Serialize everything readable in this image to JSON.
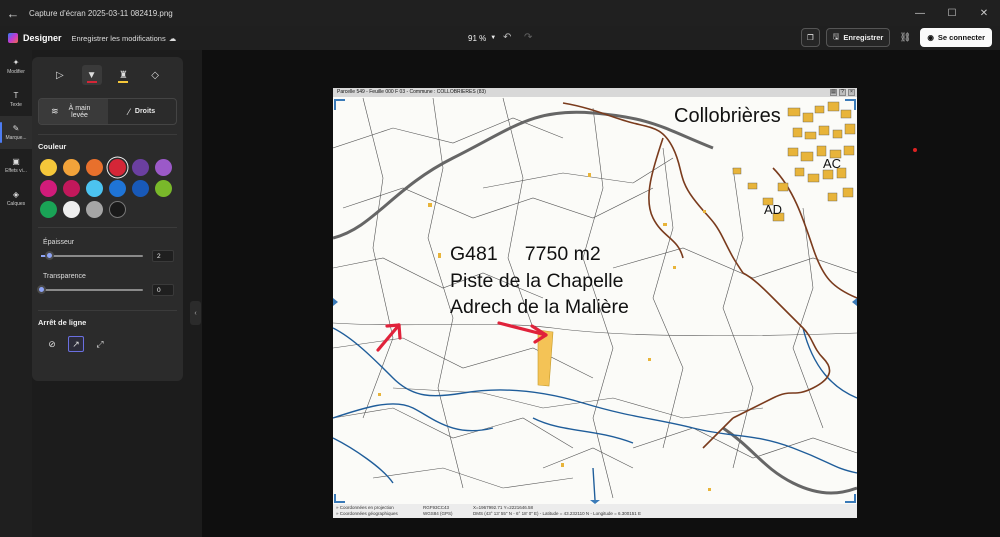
{
  "window": {
    "title": "Capture d'écran 2025-03-11 082419.png",
    "controls": [
      "—",
      "☐",
      "✕"
    ]
  },
  "appbar": {
    "app_name": "Designer",
    "save_changes": "Enregistrer les modifications",
    "zoom": "91 %",
    "save_button": "Enregistrer",
    "signin_button": "Se connecter"
  },
  "nav": [
    {
      "label": "Modifier",
      "icon": "magic-wand-icon",
      "active": false
    },
    {
      "label": "Texte",
      "icon": "text-icon",
      "active": false
    },
    {
      "label": "Marque...",
      "icon": "marker-icon",
      "active": true
    },
    {
      "label": "Effets vi...",
      "icon": "effects-icon",
      "active": false
    },
    {
      "label": "Calques",
      "icon": "layers-icon",
      "active": false
    }
  ],
  "panel": {
    "mode_freehand": "À main levée",
    "mode_straight": "Droits",
    "color_label": "Couleur",
    "colors": [
      "#f5c73a",
      "#f2a33a",
      "#e8702c",
      "#d42637",
      "#6b3fa0",
      "#9b59c8",
      "#d11b7a",
      "#c2185b",
      "#4cc3f0",
      "#1f74d6",
      "#1859b8",
      "#79b82a",
      "#1aa356",
      "#eeeeee",
      "#a6a6a6",
      "#1a1a1a"
    ],
    "selected_color": "#d42637",
    "thickness_label": "Épaisseur",
    "thickness_value": "2",
    "thickness_level": 0.08,
    "transparency_label": "Transparence",
    "transparency_value": "0",
    "transparency_level": 0,
    "line_end_label": "Arrêt de ligne"
  },
  "document": {
    "header": "Parcelle 549 - Feuille 000 F 03 - Commune : COLLOBRIERES (83)",
    "town_label": "Collobrières",
    "section_ac": "AC",
    "section_ad": "AD",
    "annotation_line1": "G481     7750 m2",
    "annotation_line2": "Piste de la Chapelle",
    "annotation_line3": "Adrech de la Malière",
    "footer": {
      "c1": "» Coordonnées en projection",
      "c2": "» Coordonnées géographiques",
      "c3": "RGF93CC43",
      "c4": "WGS84 (GPS)",
      "c5": "X=1967992.71   Y=2221646.58",
      "c6": "DMS (43° 13' 55\" N - 6° 18' 0\" E) - Latitude = 43.232110 N - Longitude = 6.300151 E"
    }
  }
}
